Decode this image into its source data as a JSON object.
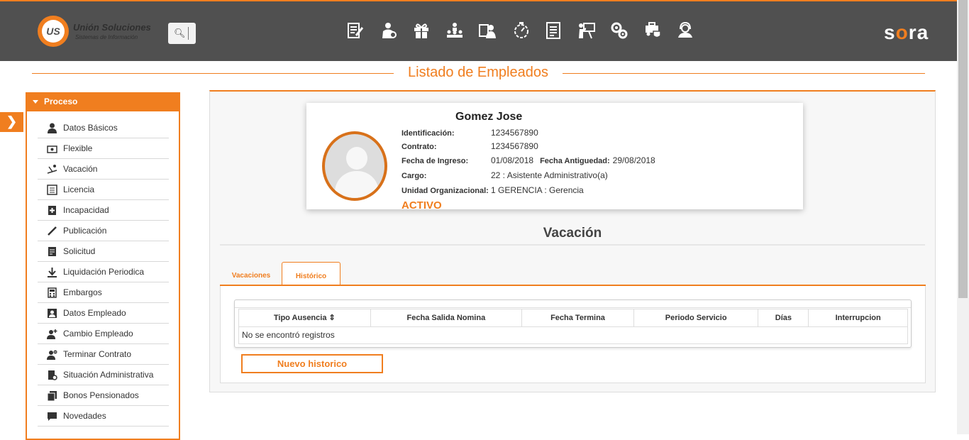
{
  "header": {
    "logo_mark": "US",
    "logo_name": "Unión Soluciones",
    "logo_sub": "Sistemas de Información",
    "brand_left": "s",
    "brand_dot": "o",
    "brand_right": "ra",
    "nav_icons": [
      "edit-document-icon",
      "person-money-icon",
      "gift-icon",
      "org-hierarchy-icon",
      "id-card-person-icon",
      "stopwatch-icon",
      "report-list-icon",
      "presentation-icon",
      "gears-icon",
      "ambulance-shield-icon",
      "user-support-icon"
    ]
  },
  "page": {
    "title": "Listado de Empleados"
  },
  "sidebar": {
    "header": "Proceso",
    "items": [
      {
        "label": "Datos Básicos",
        "icon": "user-icon"
      },
      {
        "label": "Flexible",
        "icon": "money-icon"
      },
      {
        "label": "Vacación",
        "icon": "beach-chair-icon"
      },
      {
        "label": "Licencia",
        "icon": "list-icon"
      },
      {
        "label": "Incapacidad",
        "icon": "medical-book-icon"
      },
      {
        "label": "Publicación",
        "icon": "pen-icon"
      },
      {
        "label": "Solicitud",
        "icon": "form-icon"
      },
      {
        "label": "Liquidación Periodica",
        "icon": "download-icon"
      },
      {
        "label": "Embargos",
        "icon": "calculator-icon"
      },
      {
        "label": "Datos Empleado",
        "icon": "contact-icon"
      },
      {
        "label": "Cambio Empleado",
        "icon": "user-add-icon"
      },
      {
        "label": "Terminar Contrato",
        "icon": "user-remove-icon"
      },
      {
        "label": "Situación Administrativa",
        "icon": "document-gear-icon"
      },
      {
        "label": "Bonos Pensionados",
        "icon": "copy-icon"
      },
      {
        "label": "Novedades",
        "icon": "chat-icon"
      }
    ]
  },
  "employee": {
    "name": "Gomez Jose",
    "identificacion_label": "Identificación:",
    "identificacion": "1234567890",
    "contrato_label": "Contrato:",
    "contrato": "1234567890",
    "ingreso_label": "Fecha de Ingreso:",
    "ingreso": "01/08/2018",
    "antiguedad_label": "Fecha Antiguedad:",
    "antiguedad": "29/08/2018",
    "cargo_label": "Cargo:",
    "cargo": "22 : Asistente Administrativo(a)",
    "unidad_label": "Unidad Organizacional:",
    "unidad": "1 GERENCIA : Gerencia",
    "status": "ACTIVO"
  },
  "section": {
    "title": "Vacación",
    "tabs": [
      "Vacaciones",
      "Histórico"
    ],
    "active_tab": "Histórico"
  },
  "table": {
    "columns": [
      "Tipo Ausencia",
      "Fecha Salida Nomina",
      "Fecha Termina",
      "Periodo Servicio",
      "Días",
      "Interrupcion"
    ],
    "sort_indicator": "⇕",
    "empty_message": "No se encontró registros"
  },
  "actions": {
    "new_button": "Nuevo historico"
  },
  "colors": {
    "accent": "#f07e1f",
    "topbar": "#505050"
  }
}
